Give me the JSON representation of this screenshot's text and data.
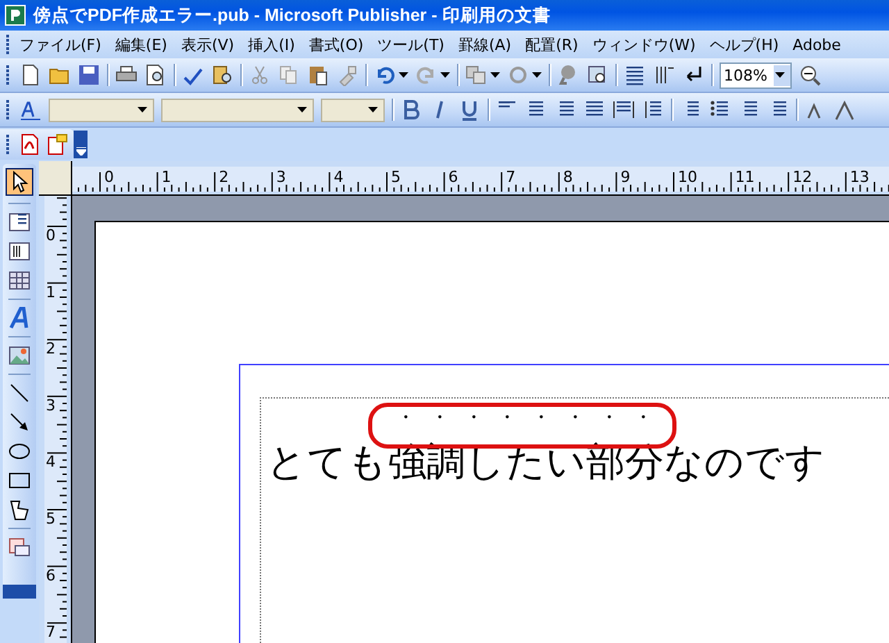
{
  "window": {
    "title": "傍点でPDF作成エラー.pub - Microsoft Publisher - 印刷用の文書"
  },
  "menu": [
    "ファイル(F)",
    "編集(E)",
    "表示(V)",
    "挿入(I)",
    "書式(O)",
    "ツール(T)",
    "罫線(A)",
    "配置(R)",
    "ウィンドウ(W)",
    "ヘルプ(H)",
    "Adobe"
  ],
  "toolbar": {
    "zoom": "108%"
  },
  "rulers": {
    "horizontal": [
      "0",
      "1",
      "2",
      "3",
      "4",
      "5",
      "6",
      "7",
      "8",
      "9",
      "10",
      "11",
      "12",
      "13"
    ],
    "vertical": [
      "0",
      "1",
      "2",
      "3",
      "4",
      "5",
      "6",
      "7"
    ]
  },
  "document": {
    "emphasis_marks": "・・・・・・・・",
    "text": "とても強調したい部分なのです"
  }
}
